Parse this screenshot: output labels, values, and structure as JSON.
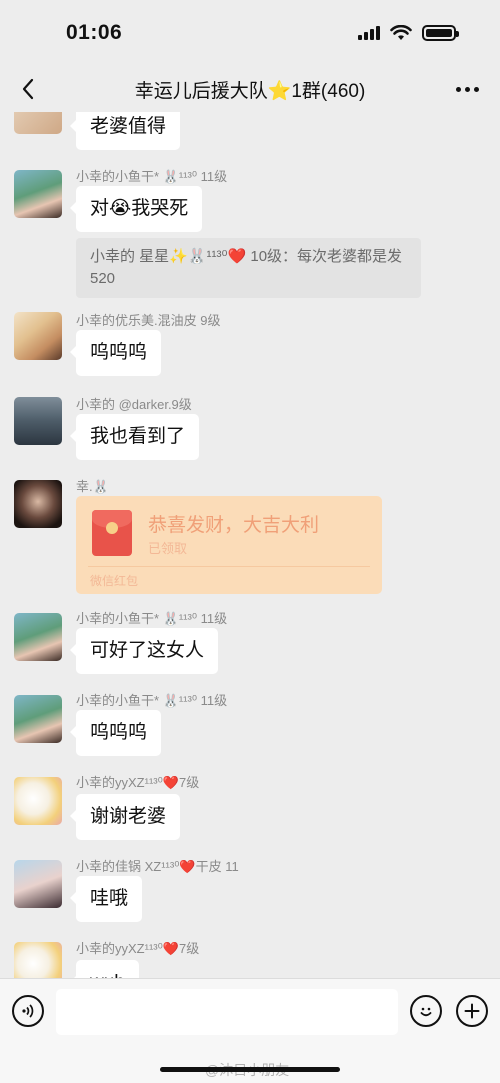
{
  "status_bar": {
    "time": "01:06"
  },
  "nav": {
    "title": "幸运儿后援大队⭐1群(460)"
  },
  "messages": [
    {
      "bubble": "老婆值得"
    },
    {
      "sender": "小幸的小鱼干* 🐰¹¹³⁰ 11级",
      "bubble": "对😭我哭死",
      "quote": "小幸的 星星✨🐰¹¹³⁰❤️ 10级：每次老婆都是发520"
    },
    {
      "sender": "小幸的优乐美.混油皮 9级",
      "bubble": "呜呜呜"
    },
    {
      "sender": "小幸的 @darker.9级",
      "bubble": "我也看到了"
    },
    {
      "sender": "幸.🐰",
      "red_packet": {
        "title": "恭喜发财，大吉大利",
        "status": "已领取",
        "footer": "微信红包"
      }
    },
    {
      "sender": "小幸的小鱼干* 🐰¹¹³⁰ 11级",
      "bubble": "可好了这女人"
    },
    {
      "sender": "小幸的小鱼干* 🐰¹¹³⁰ 11级",
      "bubble": "呜呜呜"
    },
    {
      "sender": "小幸的yyXZ¹¹³⁰❤️7级",
      "bubble": "谢谢老婆"
    },
    {
      "sender": "小幸的佳锅 XZ¹¹³⁰❤️干皮 11",
      "bubble": "哇哦"
    },
    {
      "sender": "小幸的yyXZ¹¹³⁰❤️7级",
      "bubble": "wuh"
    }
  ],
  "watermark": "@沐目小朋友",
  "icons": {
    "back": "chevron-left-icon",
    "more": "more-dots-icon",
    "voice": "voice-icon",
    "emoji": "emoji-icon",
    "plus": "plus-icon",
    "red_packet": "red-packet-icon"
  },
  "colors": {
    "background": "#ededed",
    "bubble": "#ffffff",
    "red_packet": "#fbdcb8"
  }
}
